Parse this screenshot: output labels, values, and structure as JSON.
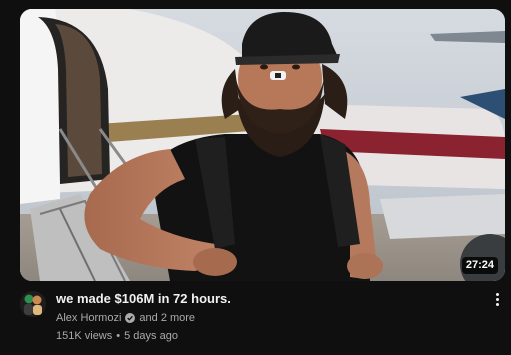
{
  "video": {
    "duration": "27:24",
    "title": "we made $106M in 72 hours.",
    "channel": "Alex Hormozi",
    "collaborators": "and 2 more",
    "views": "151K views",
    "separator": "•",
    "age": "5 days ago"
  },
  "icons": {
    "verified": "verified-check-icon",
    "more": "more-vertical-icon"
  },
  "colors": {
    "background": "#0f0f0f",
    "title": "#f1f1f1",
    "secondary_text": "#aaaaaa",
    "duration_badge": "#000000"
  }
}
